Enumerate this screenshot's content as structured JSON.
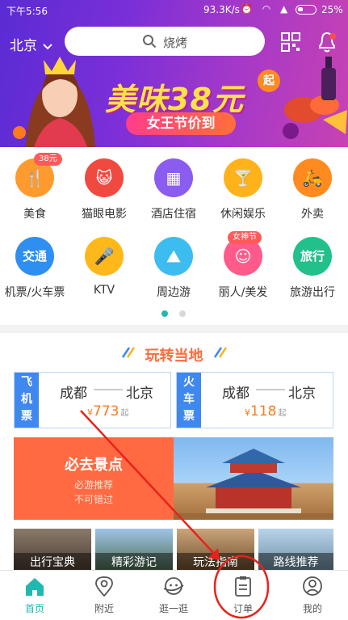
{
  "status_bar": {
    "time": "下午5:56",
    "network": "93.3K/s",
    "battery": "25%"
  },
  "header": {
    "city": "北京",
    "search_placeholder": "烧烤"
  },
  "banner": {
    "title": "美味38元",
    "badge": "起",
    "subtitle": "女王节价到"
  },
  "categories": [
    {
      "label": "美食",
      "icon": "fork-knife-icon",
      "color": "#ff9a2e",
      "tag": "38元"
    },
    {
      "label": "猫眼电影",
      "icon": "cat-face-icon",
      "color": "#f0493f",
      "tag": ""
    },
    {
      "label": "酒店住宿",
      "icon": "building-icon",
      "color": "#8b5cf0",
      "tag": ""
    },
    {
      "label": "休闲娱乐",
      "icon": "cocktail-icon",
      "color": "#ffb21a",
      "tag": ""
    },
    {
      "label": "外卖",
      "icon": "scooter-icon",
      "color": "#ff8a1f",
      "tag": ""
    },
    {
      "label": "机票/火车票",
      "icon": "transport-icon",
      "color": "#2e8ff0",
      "tag": "",
      "glyph": "交通"
    },
    {
      "label": "KTV",
      "icon": "microphone-icon",
      "color": "#ffb81a",
      "tag": ""
    },
    {
      "label": "周边游",
      "icon": "landscape-icon",
      "color": "#3dbcf0",
      "tag": ""
    },
    {
      "label": "丽人/美发",
      "icon": "beauty-face-icon",
      "color": "#ff5a8a",
      "tag": "女神节"
    },
    {
      "label": "旅游出行",
      "icon": "travel-icon",
      "color": "#22c08a",
      "tag": "",
      "glyph": "旅行"
    }
  ],
  "pager": {
    "active_color": "#20b8b0",
    "inactive_color": "#d8d8d8"
  },
  "local_section": {
    "title": "玩转当地",
    "flight": {
      "tag": "飞机票",
      "from": "成都",
      "to": "北京",
      "currency": "¥",
      "price": "773",
      "suffix": "起"
    },
    "train": {
      "tag": "火车票",
      "from": "成都",
      "to": "北京",
      "currency": "¥",
      "price": "118",
      "suffix": "起"
    },
    "must_visit": {
      "title": "必去景点",
      "line1": "必游推荐",
      "line2": "不可错过"
    },
    "tiles": [
      "出行宝典",
      "精彩游记",
      "玩法指南",
      "路线推荐"
    ]
  },
  "bottom_nav": [
    {
      "label": "首页",
      "icon": "home-icon",
      "active": true
    },
    {
      "label": "附近",
      "icon": "location-icon",
      "active": false
    },
    {
      "label": "逛一逛",
      "icon": "planet-face-icon",
      "active": false
    },
    {
      "label": "订单",
      "icon": "order-list-icon",
      "active": false
    },
    {
      "label": "我的",
      "icon": "user-icon",
      "active": false
    }
  ],
  "colors": {
    "accent": "#20b8b0",
    "price": "#ff7a1a",
    "annotation": "#e8221a"
  }
}
